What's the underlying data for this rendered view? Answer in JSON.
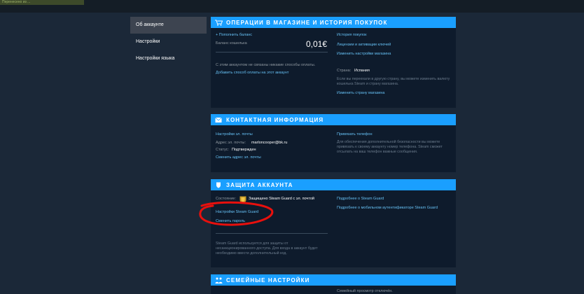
{
  "top_badge": "Перенесено из ...",
  "sidebar": {
    "items": [
      {
        "label": "Об аккаунте"
      },
      {
        "label": "Настройки"
      },
      {
        "label": "Настройки языка"
      }
    ]
  },
  "store": {
    "title": "ОПЕРАЦИИ В МАГАЗИНЕ И ИСТОРИЯ ПОКУПОК",
    "add_funds": "+ Пополнить баланс",
    "wallet_label": "Баланс кошелька",
    "wallet_value": "0,01€",
    "no_payment_text": "С этим аккаунтом не связаны никакие способы оплаты.",
    "add_payment": "Добавить способ оплаты на этот аккаунт",
    "purchase_history": "История покупок",
    "licenses": "Лицензии и активации ключей",
    "store_settings": "Изменить настройки магазина",
    "country_label": "Страна:",
    "country_value": "Испания",
    "country_note": "Если вы переехали в другую страну, вы можете изменить валюту кошелька Steam и страну магазина.",
    "change_country": "Изменить страну магазина"
  },
  "contact": {
    "title": "КОНТАКТНАЯ ИНФОРМАЦИЯ",
    "email_settings": "Настройки эл. почты",
    "email_label": "Адрес эл. почты:",
    "email_value": "marloncooper@bk.ru",
    "status_label": "Статус:",
    "status_value": "Подтвержден",
    "change_email": "Сменить адрес эл. почты",
    "add_phone": "Привязать телефон",
    "phone_note": "Для обеспечения дополнительной безопасности вы можете привязать к своему аккаунту номер телефона. Steam сможет отсылать на ваш телефон важные сообщения."
  },
  "security": {
    "title": "ЗАЩИТА АККАУНТА",
    "state_label": "Состояние:",
    "state_value": "Защищено Steam Guard с эл. почтой",
    "guard_settings": "Настройки Steam Guard",
    "change_password": "Сменить пароль",
    "more_guard": "Подробнее о Steam Guard",
    "more_mobile": "Подробнее о мобильном аутентификаторе Steam Guard",
    "guard_note": "Steam Guard используется для защиты от несанкционированного доступа. Для входа в аккаунт будет необходимо ввести дополнительный код."
  },
  "family": {
    "title": "СЕМЕЙНЫЕ НАСТРОЙКИ",
    "status_text": "Семейный просмотр отключён."
  },
  "colors": {
    "background": "#1b2838",
    "panel": "#0e1b2c",
    "header": "#1a9fff",
    "link": "#66c0f4",
    "annotation": "#e8100d"
  }
}
